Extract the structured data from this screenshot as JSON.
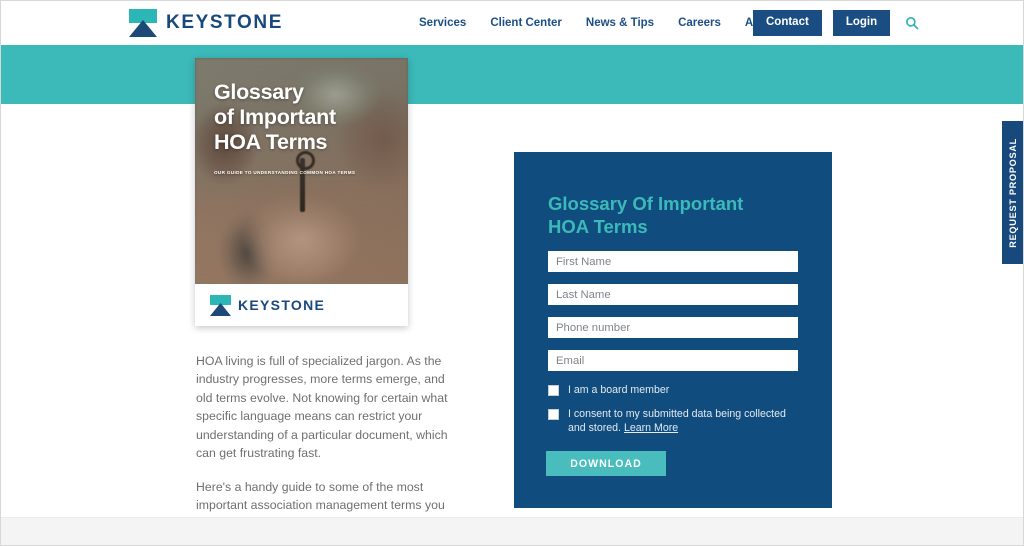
{
  "header": {
    "brand_name": "KEYSTONE",
    "logo_icon": "keystone-mountain-icon",
    "nav_items": [
      {
        "label": "Services"
      },
      {
        "label": "Client Center"
      },
      {
        "label": "News & Tips"
      },
      {
        "label": "Careers"
      },
      {
        "label": "About"
      }
    ],
    "contact_label": "Contact",
    "login_label": "Login",
    "search_icon": "search-icon"
  },
  "cover": {
    "title": "Glossary\nof Important\nHOA Terms",
    "title_line1": "Glossary",
    "title_line2": "of Important",
    "title_line3": "HOA Terms",
    "subtitle": "OUR GUIDE TO UNDERSTANDING COMMON HOA TERMS",
    "footer_brand": "KEYSTONE",
    "photo_description": "hands-forming-heart-around-key-photo"
  },
  "body": {
    "paragraph1": "HOA living is full of specialized jargon. As the industry progresses, more terms emerge, and old terms evolve. Not knowing for certain what specific language means can restrict your understanding of a particular document, which can get frustrating fast.",
    "paragraph2": "Here's a handy guide to some of the most important association management terms you need to know as well as an explanation of your governing documents."
  },
  "form": {
    "title_line1": "Glossary Of Important",
    "title_line2": "HOA Terms",
    "fields": [
      {
        "name": "first-name",
        "placeholder": "First Name",
        "value": ""
      },
      {
        "name": "last-name",
        "placeholder": "Last Name",
        "value": ""
      },
      {
        "name": "phone-number",
        "placeholder": "Phone number",
        "value": ""
      },
      {
        "name": "email",
        "placeholder": "Email",
        "value": ""
      }
    ],
    "checkbox_board_label": "I am a board member",
    "checkbox_consent_label": "I consent to my submitted data being collected and stored.",
    "learn_more_label": "Learn More",
    "submit_label": "DOWNLOAD"
  },
  "side_tab": {
    "label": "REQUEST PROPOSAL"
  },
  "colors": {
    "navy": "#18497d",
    "panel_navy": "#104d7e",
    "teal": "#3cb9b9",
    "button_teal": "#49bdbd",
    "body_text": "#6d6f72",
    "white": "#ffffff"
  }
}
